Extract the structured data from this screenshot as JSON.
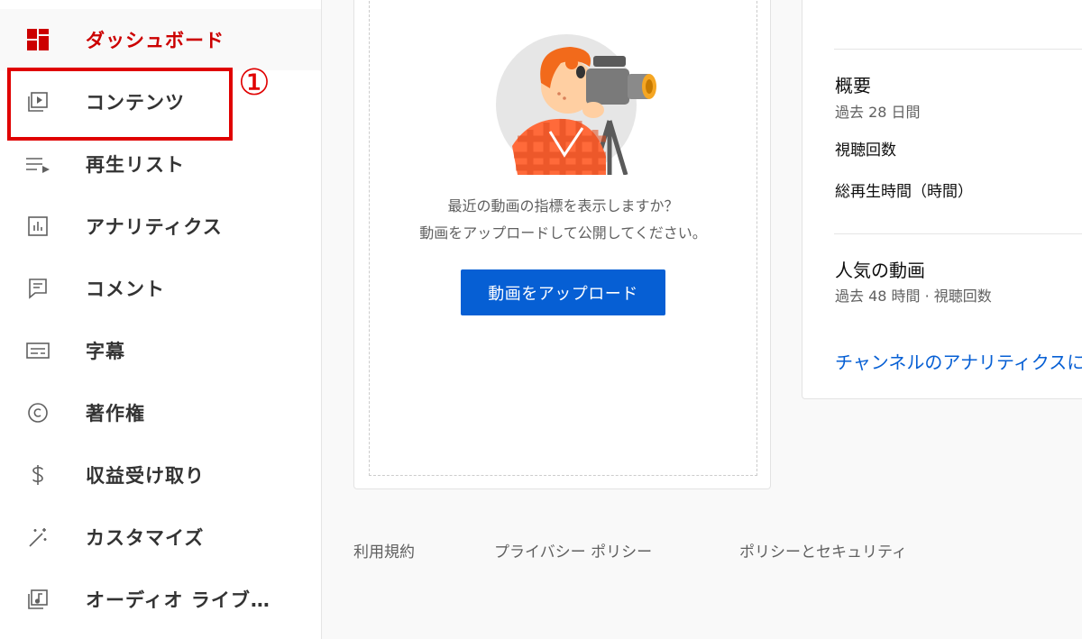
{
  "sidebar": {
    "items": [
      {
        "label": "ダッシュボード",
        "icon": "dashboard-icon",
        "active": true
      },
      {
        "label": "コンテンツ",
        "icon": "content-icon"
      },
      {
        "label": "再生リスト",
        "icon": "playlist-icon"
      },
      {
        "label": "アナリティクス",
        "icon": "analytics-icon"
      },
      {
        "label": "コメント",
        "icon": "comment-icon"
      },
      {
        "label": "字幕",
        "icon": "subtitles-icon"
      },
      {
        "label": "著作権",
        "icon": "copyright-icon"
      },
      {
        "label": "収益受け取り",
        "icon": "dollar-icon"
      },
      {
        "label": "カスタマイズ",
        "icon": "magic-wand-icon"
      },
      {
        "label": "オーディオ ライブ…",
        "icon": "audio-library-icon"
      }
    ]
  },
  "annotation": {
    "number": "①"
  },
  "upload_card": {
    "prompt_line1": "最近の動画の指標を表示しますか？",
    "prompt_line2": "動画をアップロードして公開してください。",
    "button_label": "動画をアップロード"
  },
  "analytics_card": {
    "summary_title": "概要",
    "summary_period": "過去 28 日間",
    "views_label": "視聴回数",
    "watch_time_label": "総再生時間（時間）",
    "top_videos_title": "人気の動画",
    "top_videos_period": "過去 48 時間 · 視聴回数",
    "link_text": "チャンネルのアナリティクスに"
  },
  "footer": {
    "terms": "利用規約",
    "privacy": "プライバシー ポリシー",
    "policy_security": "ポリシーとセキュリティ"
  },
  "colors": {
    "accent_red": "#cc0000",
    "annotation_red": "#e00000",
    "button_blue": "#065fd4"
  }
}
